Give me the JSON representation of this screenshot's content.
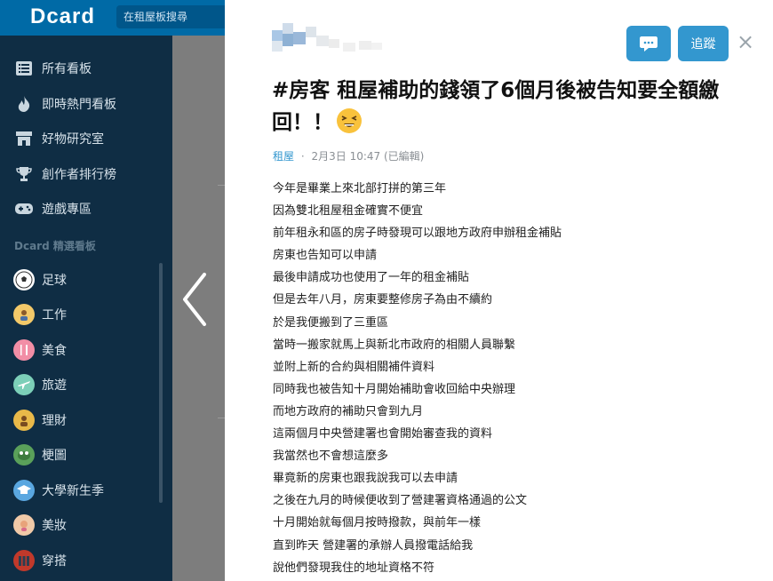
{
  "header": {
    "logo": "Dcard",
    "search_placeholder": "在租屋板搜尋"
  },
  "sidebar": {
    "main_items": [
      {
        "label": "所有看板",
        "icon": "list-icon"
      },
      {
        "label": "即時熱門看板",
        "icon": "fire-icon"
      },
      {
        "label": "好物研究室",
        "icon": "store-icon"
      },
      {
        "label": "創作者排行榜",
        "icon": "trophy-icon"
      },
      {
        "label": "遊戲專區",
        "icon": "gamepad-icon"
      }
    ],
    "section_title": "Dcard 精選看板",
    "boards": [
      {
        "label": "足球",
        "icon": "soccer-ball-icon",
        "color": "#ffffff"
      },
      {
        "label": "工作",
        "icon": "work-icon",
        "color": "#f3c969"
      },
      {
        "label": "美食",
        "icon": "food-icon",
        "color": "#f28ea6"
      },
      {
        "label": "旅遊",
        "icon": "travel-icon",
        "color": "#7ccfb8"
      },
      {
        "label": "理財",
        "icon": "finance-icon",
        "color": "#e9b949"
      },
      {
        "label": "梗圖",
        "icon": "meme-icon",
        "color": "#5aa05a"
      },
      {
        "label": "大學新生季",
        "icon": "graduation-icon",
        "color": "#5aa7e0"
      },
      {
        "label": "美妝",
        "icon": "makeup-icon",
        "color": "#f0c9a8"
      },
      {
        "label": "穿搭",
        "icon": "outfit-icon",
        "color": "#c0392b"
      }
    ]
  },
  "post": {
    "follow_label": "追蹤",
    "title_text": "#房客 租屋補助的錢領了6個月後被告知要全額繳回！！",
    "title_emoji": "tired-face-emoji",
    "forum": "租屋",
    "separator": "·",
    "date": "2月3日 10:47 (已編輯)",
    "body": [
      "今年是畢業上來北部打拼的第三年",
      "因為雙北租屋租金確實不便宜",
      "前年租永和區的房子時發現可以跟地方政府申辦租金補貼",
      "房東也告知可以申請",
      "最後申請成功也使用了一年的租金補貼",
      "但是去年八月，房東要整修房子為由不續約",
      "於是我便搬到了三重區",
      "當時一搬家就馬上與新北市政府的相關人員聯繫",
      "並附上新的合約與相關補件資料",
      "同時我也被告知十月開始補助會收回給中央辦理",
      "而地方政府的補助只會到九月",
      "這兩個月中央營建署也會開始審查我的資料",
      "我當然也不會想這麼多",
      "畢竟新的房東也跟我說我可以去申請",
      "之後在九月的時候便收到了營建署資格通過的公文",
      "十月開始就每個月按時撥款，與前年一樣",
      "直到昨天 營建署的承辦人員撥電話給我",
      "說他們發現我住的地址資格不符"
    ]
  },
  "colors": {
    "brand": "#006aa6",
    "accent_button": "#3397cf",
    "sidebar_bg": "#0f2d44"
  }
}
